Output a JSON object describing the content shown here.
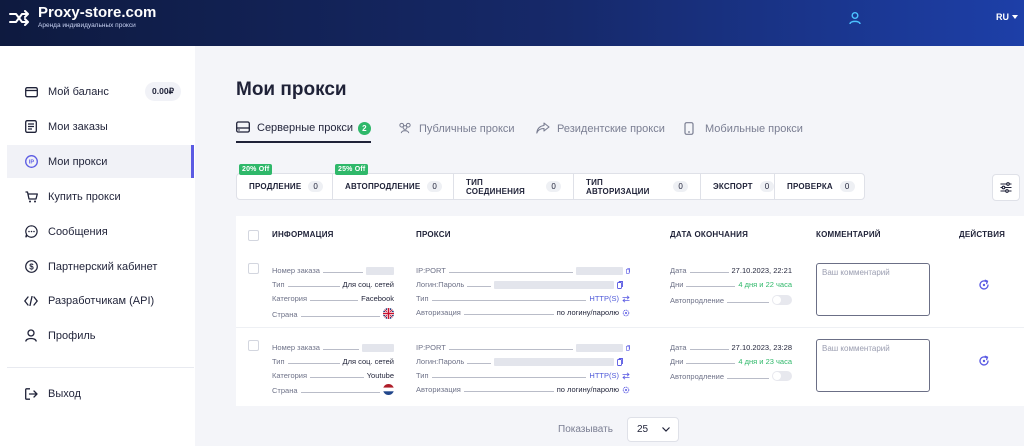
{
  "header": {
    "brand": "Proxy-store.com",
    "tagline": "Аренда индивидуальных прокси",
    "language": "RU"
  },
  "sidebar": {
    "items": [
      {
        "label": "Мой баланс",
        "icon": "wallet-icon",
        "badge": "0.00₽"
      },
      {
        "label": "Мои заказы",
        "icon": "orders-icon"
      },
      {
        "label": "Мои прокси",
        "icon": "ip-icon",
        "active": true
      },
      {
        "label": "Купить прокси",
        "icon": "cart-icon"
      },
      {
        "label": "Сообщения",
        "icon": "chat-icon"
      },
      {
        "label": "Партнерский кабинет",
        "icon": "dollar-icon"
      },
      {
        "label": "Разработчикам (API)",
        "icon": "code-icon"
      },
      {
        "label": "Профиль",
        "icon": "user-icon"
      }
    ],
    "logout": "Выход"
  },
  "page": {
    "title": "Мои прокси"
  },
  "tabs": [
    {
      "label": "Серверные прокси",
      "count": "2",
      "icon": "server-icon",
      "active": true
    },
    {
      "label": "Публичные прокси",
      "icon": "people-icon"
    },
    {
      "label": "Резидентские прокси",
      "icon": "share-arrow-icon"
    },
    {
      "label": "Мобильные прокси",
      "icon": "phone-icon"
    }
  ],
  "filters": [
    {
      "label": "ПРОДЛЕНИЕ",
      "count": "0",
      "promo": "20% Off"
    },
    {
      "label": "АВТОПРОДЛЕНИЕ",
      "count": "0",
      "promo": "25% Off"
    },
    {
      "label": "ТИП СОЕДИНЕНИЯ",
      "count": "0"
    },
    {
      "label": "ТИП АВТОРИЗАЦИИ",
      "count": "0"
    },
    {
      "label": "ЭКСПОРТ",
      "count": "0"
    },
    {
      "label": "ПРОВЕРКА",
      "count": "0"
    }
  ],
  "table": {
    "headers": {
      "info": "ИНФОРМАЦИЯ",
      "proxy": "ПРОКСИ",
      "end_date": "ДАТА ОКОНЧАНИЯ",
      "comment": "КОММЕНТАРИЙ",
      "actions": "ДЕЙСТВИЯ"
    },
    "labels": {
      "order": "Номер заказа",
      "type": "Тип",
      "category": "Категория",
      "country": "Страна",
      "ipport": "IP:PORT",
      "login": "Логин:Пароль",
      "ptype": "Тип",
      "auth": "Авторизация",
      "date": "Дата",
      "days": "Дни",
      "autorenew": "Автопродление"
    },
    "comment_placeholder": "Ваш комментарий",
    "rows": [
      {
        "type": "Для соц. сетей",
        "category": "Facebook",
        "country_flag": "uk-flag-icon",
        "proxy_type": "HTTP(S)",
        "auth": "по логину/паролю",
        "date": "27.10.2023, 22:21",
        "days": "4 дня и 22 часа"
      },
      {
        "type": "Для соц. сетей",
        "category": "Youtube",
        "country_flag": "nl-flag-icon",
        "proxy_type": "HTTP(S)",
        "auth": "по логину/паролю",
        "date": "27.10.2023, 23:28",
        "days": "4 дня и 23 часа"
      }
    ]
  },
  "pagination": {
    "show_label": "Показывать",
    "per_page": "25"
  },
  "colors": {
    "accent": "#5b5be3",
    "green": "#2fb86a",
    "header_dark": "#0e1a3f"
  }
}
